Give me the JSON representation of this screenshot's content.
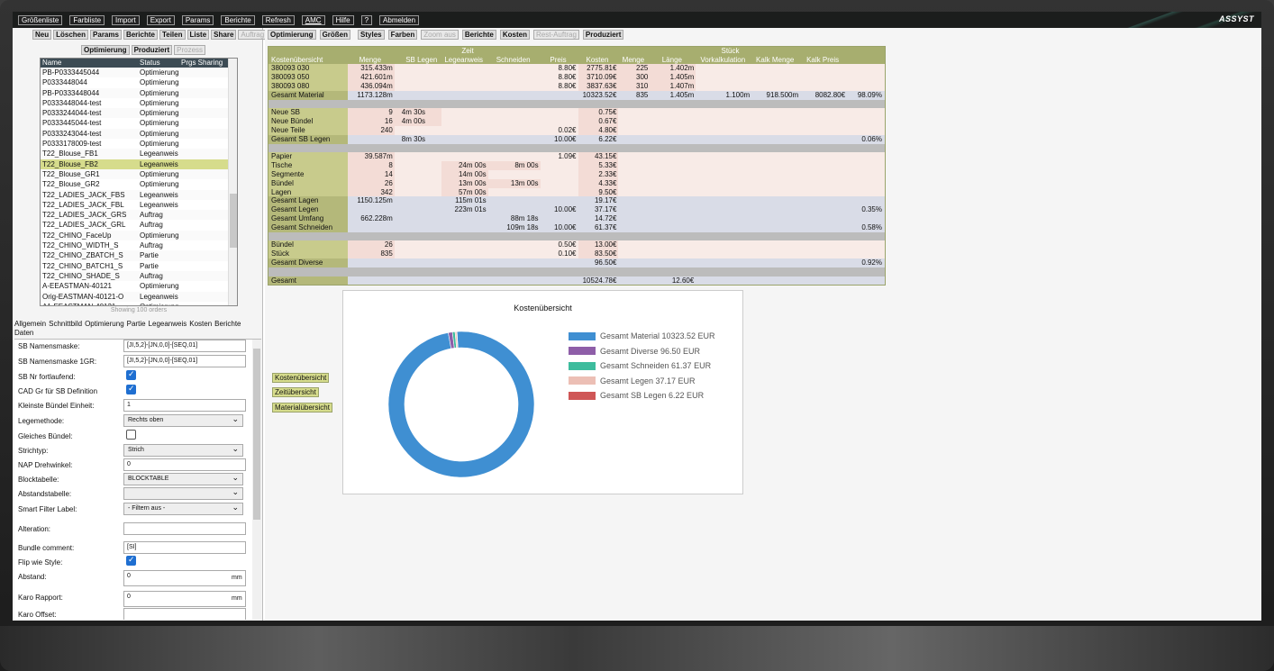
{
  "menu": [
    "Größenliste",
    "Farbliste",
    "Import",
    "Export",
    "Params",
    "Berichte",
    "Refresh",
    "AMC",
    "Hilfe",
    "?",
    "Abmelden"
  ],
  "brand": "ASSYST",
  "left_toolbar": {
    "buttons": [
      "Neu",
      "Löschen",
      "Params",
      "Berichte",
      "Teilen",
      "Liste",
      "Share",
      "Auftrag"
    ],
    "buttons2": [
      "Optimierung",
      "Produziert",
      "Prozess"
    ]
  },
  "orders": {
    "headers": [
      "Name",
      "Status",
      "Prgs Sharing"
    ],
    "rows": [
      [
        "PB-P0333445044",
        "Optimierung"
      ],
      [
        "P0333448044",
        "Optimierung"
      ],
      [
        "PB-P0333448044",
        "Optimierung"
      ],
      [
        "P0333448044-test",
        "Optimierung"
      ],
      [
        "P0333244044-test",
        "Optimierung"
      ],
      [
        "P0333445044-test",
        "Optimierung"
      ],
      [
        "P0333243044-test",
        "Optimierung"
      ],
      [
        "P0333178009-test",
        "Optimierung"
      ],
      [
        "T22_Blouse_FB1",
        "Legeanweis"
      ],
      [
        "T22_Blouse_FB2",
        "Legeanweis"
      ],
      [
        "T22_Blouse_GR1",
        "Optimierung"
      ],
      [
        "T22_Blouse_GR2",
        "Optimierung"
      ],
      [
        "T22_LADIES_JACK_FBS",
        "Legeanweis"
      ],
      [
        "T22_LADIES_JACK_FBL",
        "Legeanweis"
      ],
      [
        "T22_LADIES_JACK_GRS",
        "Auftrag"
      ],
      [
        "T22_LADIES_JACK_GRL",
        "Auftrag"
      ],
      [
        "T22_CHINO_FaceUp",
        "Optimierung"
      ],
      [
        "T22_CHINO_WIDTH_S",
        "Auftrag"
      ],
      [
        "T22_CHINO_ZBATCH_S",
        "Partie"
      ],
      [
        "T22_CHINO_BATCH1_S",
        "Partie"
      ],
      [
        "T22_CHINO_SHADE_S",
        "Auftrag"
      ],
      [
        "A-EEASTMAN-40121",
        "Optimierung"
      ],
      [
        "Orig-EASTMAN-40121-O",
        "Legeanweis"
      ],
      [
        "A1-EEASTMAN-40121",
        "Optimierung"
      ]
    ],
    "footer": "Showing 100 orders"
  },
  "tabs": [
    "Allgemein",
    "Schnittbild",
    "Optimierung",
    "Partie",
    "Legeanweis",
    "Kosten",
    "Berichte",
    "Daten"
  ],
  "props": [
    {
      "label": "SB Namensmaske:",
      "type": "input",
      "value": "[JI,5,2]-[JN,0,0]-[SEQ,01]"
    },
    {
      "label": "SB Namensmaske 1GR:",
      "type": "input",
      "value": "[JI,5,2]-[JN,0,0]-[SEQ,01]"
    },
    {
      "label": "SB Nr fortlaufend:",
      "type": "check",
      "value": "on"
    },
    {
      "label": "CAD Gr für SB Definition",
      "type": "check",
      "value": "on"
    },
    {
      "label": "Kleinste Bündel Einheit:",
      "type": "input",
      "value": "1"
    },
    {
      "label": "Legemethode:",
      "type": "select",
      "value": "Rechts oben"
    },
    {
      "label": "Gleiches Bündel:",
      "type": "check",
      "value": "off"
    },
    {
      "label": "Strichtyp:",
      "type": "select",
      "value": "Strich"
    },
    {
      "label": "NAP Drehwinkel:",
      "type": "input",
      "value": "0"
    },
    {
      "label": "Blocktabelle:",
      "type": "select",
      "value": "BLOCKTABLE"
    },
    {
      "label": "Abstandstabelle:",
      "type": "select",
      "value": ""
    },
    {
      "label": "Smart Filter Label:",
      "type": "select",
      "value": "- Filtern aus -"
    },
    {
      "label": "Alteration:",
      "type": "input",
      "value": ""
    },
    {
      "label": "Bundle comment:",
      "type": "input",
      "value": "[SI]"
    },
    {
      "label": "Flip wie Style:",
      "type": "check",
      "value": "on"
    },
    {
      "label": "Abstand:",
      "type": "input",
      "value": "0",
      "unit": "mm"
    },
    {
      "label": "Karo Rapport:",
      "type": "input",
      "value": "0",
      "unit": "mm"
    },
    {
      "label": "Karo Offset:",
      "type": "input",
      "value": ""
    }
  ],
  "right_toolbar": {
    "buttons": [
      "Optimierung",
      "Größen",
      "Styles",
      "Farben",
      "Zoom aus",
      "Berichte",
      "Kosten",
      "Rest-Auftrag",
      "Produziert"
    ]
  },
  "cost_table": {
    "group_headers": [
      "Zeit",
      "Stück"
    ],
    "headers": [
      "Kostenübersicht",
      "Menge",
      "SB Legen",
      "Legeanweis",
      "Schneiden",
      "Preis",
      "Kosten",
      "Menge",
      "Länge",
      "Vorkalkulation",
      "Kalk Menge",
      "Kalk Preis",
      ""
    ],
    "rows": [
      [
        "380093 030",
        "315.433m",
        "",
        "",
        "",
        "8.80€",
        "2775.81€",
        "225",
        "1.402m",
        "",
        "",
        "",
        ""
      ],
      [
        "380093 050",
        "421.601m",
        "",
        "",
        "",
        "8.80€",
        "3710.09€",
        "300",
        "1.405m",
        "",
        "",
        "",
        ""
      ],
      [
        "380093 080",
        "436.094m",
        "",
        "",
        "",
        "8.80€",
        "3837.63€",
        "310",
        "1.407m",
        "",
        "",
        "",
        ""
      ],
      [
        "Gesamt Material",
        "1173.128m",
        "",
        "",
        "",
        "",
        "10323.52€",
        "835",
        "1.405m",
        "1.100m",
        "918.500m",
        "8082.80€",
        "98.09%"
      ],
      null,
      [
        "Neue SB",
        "9",
        "4m 30s",
        "",
        "",
        "",
        "0.75€",
        "",
        "",
        "",
        "",
        "",
        ""
      ],
      [
        "Neue Bündel",
        "16",
        "4m 00s",
        "",
        "",
        "",
        "0.67€",
        "",
        "",
        "",
        "",
        "",
        ""
      ],
      [
        "Neue Teile",
        "240",
        "",
        "",
        "",
        "0.02€",
        "4.80€",
        "",
        "",
        "",
        "",
        "",
        ""
      ],
      [
        "Gesamt SB Legen",
        "",
        "8m 30s",
        "",
        "",
        "10.00€",
        "6.22€",
        "",
        "",
        "",
        "",
        "",
        "0.06%"
      ],
      null,
      [
        "Papier",
        "39.587m",
        "",
        "",
        "",
        "1.09€",
        "43.15€",
        "",
        "",
        "",
        "",
        "",
        ""
      ],
      [
        "Tische",
        "8",
        "",
        "24m 00s",
        "8m 00s",
        "",
        "5.33€",
        "",
        "",
        "",
        "",
        "",
        ""
      ],
      [
        "Segmente",
        "14",
        "",
        "14m 00s",
        "",
        "",
        "2.33€",
        "",
        "",
        "",
        "",
        "",
        ""
      ],
      [
        "Bündel",
        "26",
        "",
        "13m 00s",
        "13m 00s",
        "",
        "4.33€",
        "",
        "",
        "",
        "",
        "",
        ""
      ],
      [
        "Lagen",
        "342",
        "",
        "57m 00s",
        "",
        "",
        "9.50€",
        "",
        "",
        "",
        "",
        "",
        ""
      ],
      [
        "Gesamt Lagen",
        "1150.125m",
        "",
        "115m 01s",
        "",
        "",
        "19.17€",
        "",
        "",
        "",
        "",
        "",
        ""
      ],
      [
        "Gesamt Legen",
        "",
        "",
        "223m 01s",
        "",
        "10.00€",
        "37.17€",
        "",
        "",
        "",
        "",
        "",
        "0.35%"
      ],
      [
        "Gesamt Umfang",
        "662.228m",
        "",
        "",
        "88m 18s",
        "",
        "14.72€",
        "",
        "",
        "",
        "",
        "",
        ""
      ],
      [
        "Gesamt Schneiden",
        "",
        "",
        "",
        "109m 18s",
        "10.00€",
        "61.37€",
        "",
        "",
        "",
        "",
        "",
        "0.58%"
      ],
      null,
      [
        "Bündel",
        "26",
        "",
        "",
        "",
        "0.50€",
        "13.00€",
        "",
        "",
        "",
        "",
        "",
        ""
      ],
      [
        "Stück",
        "835",
        "",
        "",
        "",
        "0.10€",
        "83.50€",
        "",
        "",
        "",
        "",
        "",
        ""
      ],
      [
        "Gesamt Diverse",
        "",
        "",
        "",
        "",
        "",
        "96.50€",
        "",
        "",
        "",
        "",
        "",
        "0.92%"
      ],
      null,
      [
        "Gesamt",
        "",
        "",
        "",
        "",
        "",
        "10524.78€",
        "",
        "12.60€",
        "",
        "",
        "",
        ""
      ]
    ]
  },
  "view_buttons": [
    "Kostenübersicht",
    "Zeitübersicht",
    "Materialübersicht"
  ],
  "chart_data": {
    "type": "pie",
    "title": "Kostenübersicht",
    "categories": [
      "Gesamt Material",
      "Gesamt Diverse",
      "Gesamt Schneiden",
      "Gesamt Legen",
      "Gesamt SB Legen"
    ],
    "values": [
      10323.52,
      96.5,
      61.37,
      37.17,
      6.22
    ],
    "unit": "EUR",
    "colors": [
      "#3f8fd2",
      "#8e5ea8",
      "#3dbc9d",
      "#ecbfb5",
      "#cf5656"
    ],
    "legend_labels": [
      "Gesamt Material   10323.52 EUR",
      "Gesamt Diverse   96.50 EUR",
      "Gesamt Schneiden   61.37 EUR",
      "Gesamt Legen   37.17 EUR",
      "Gesamt SB Legen   6.22 EUR"
    ],
    "legend": "right",
    "donut": true
  }
}
